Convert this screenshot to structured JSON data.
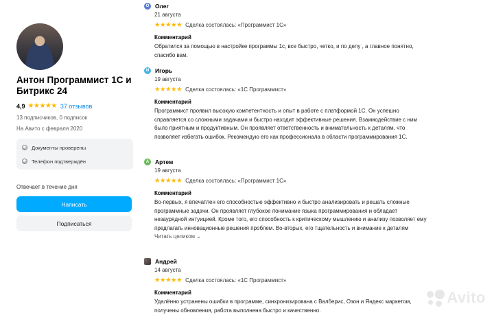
{
  "profile": {
    "name": "Антон Программист 1С и Битрикс 24",
    "rating": "4,9",
    "stars": "★★★★★",
    "reviews_count": "37 отзывов",
    "subscribers": "13 подписчиков, 0 подписок",
    "since": "На Авито с февраля 2020",
    "verifications": [
      "Документы проверены",
      "Телефон подтверждён"
    ],
    "reply_time": "Отвечает в течение дня",
    "write_button": "Написать",
    "subscribe_button": "Подписаться"
  },
  "reviews": [
    {
      "initial": "О",
      "avatar_color": "#5b7fd6",
      "name": "Олег",
      "date": "21 августа",
      "stars": "★★★★★",
      "deal": "Сделка состоялась: «Программист 1С»",
      "comment_heading": "Комментарий",
      "text": "Обратился за помощью в настройке программы 1с, все быстро, четко, и по делу , а главное понятно, спасибо вам."
    },
    {
      "initial": "И",
      "avatar_color": "#41b6e6",
      "name": "Игорь",
      "date": "19 августа",
      "stars": "★★★★★",
      "deal": "Сделка состоялась: «1С Программист»",
      "comment_heading": "Комментарий",
      "text": "Программист проявил высокую компетентность и опыт в работе с платформой 1С. Он успешно справляется со сложными задачами и быстро находит эффективные решения. Взаимодействие с ним было приятным и продуктивным. Он проявляет ответственность и внимательность к деталям, что позволяет избегать ошибок. Рекомендую его как профессионала в области программирования 1С."
    },
    {
      "initial": "А",
      "avatar_color": "#66bb55",
      "name": "Артем",
      "date": "19 августа",
      "stars": "★★★★★",
      "deal": "Сделка состоялась: «Программист 1С»",
      "comment_heading": "Комментарий",
      "text": "Во-первых, я впечатлен его способностью эффективно и быстро анализировать и решать сложные программные задачи. Он проявляет глубокое понимание языка программирования и обладает незаурядной интуицией. Кроме того, его способность к критическому мышлению и анализу позволяет ему предлагать инновационные решения проблем. Во-вторых, его тщательность и внимание к деталям являются неотъемлемыми качествами, которые сделали...",
      "read_more": "Читать целиком ⌄"
    },
    {
      "initial": "",
      "avatar_color": "#4a4244",
      "name": "Андрей",
      "date": "14 августа",
      "stars": "★★★★★",
      "deal": "Сделка состоялась: «1С Программист»",
      "comment_heading": "Комментарий",
      "text": "Удалённо устранены ошибки в программе, синхронизирована с Валберис, Озон и Яндекс маркетом, получены обновления, работа выполнена быстро и качественно."
    }
  ],
  "watermark": "Avito"
}
